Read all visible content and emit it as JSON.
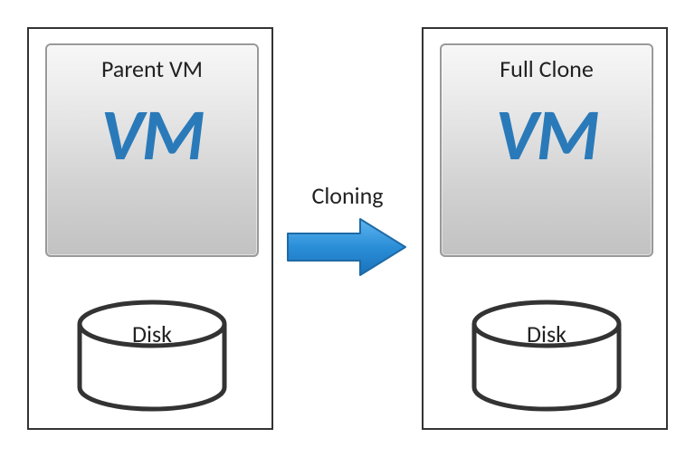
{
  "left": {
    "title": "Parent VM",
    "vmText": "VM",
    "diskLabel": "Disk"
  },
  "right": {
    "title": "Full Clone",
    "vmText": "VM",
    "diskLabel": "Disk"
  },
  "arrow": {
    "label": "Cloning"
  },
  "colors": {
    "vmAccent": "#2a7ab9",
    "arrowFill": "#2a8ed8",
    "arrowStroke": "#1f6aa5",
    "stroke": "#333"
  }
}
